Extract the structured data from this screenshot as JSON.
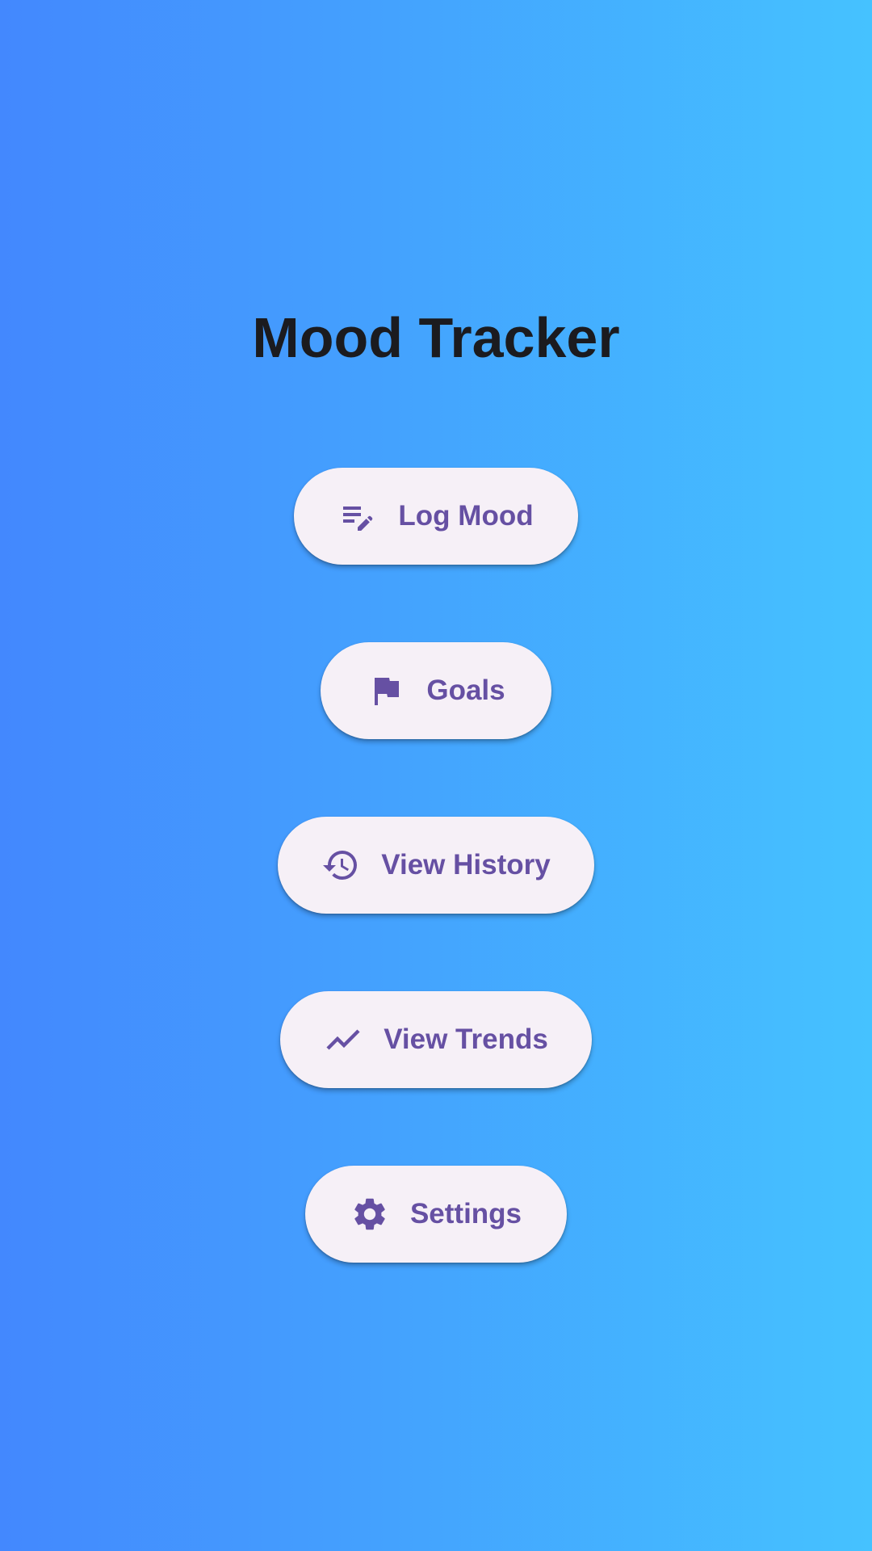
{
  "app": {
    "title": "Mood Tracker"
  },
  "menu": {
    "buttons": [
      {
        "label": "Log Mood",
        "icon": "edit-note-icon"
      },
      {
        "label": "Goals",
        "icon": "flag-icon"
      },
      {
        "label": "View History",
        "icon": "history-icon"
      },
      {
        "label": "View Trends",
        "icon": "trending-up-icon"
      },
      {
        "label": "Settings",
        "icon": "gear-icon"
      }
    ]
  },
  "colors": {
    "background_start": "#4388fe",
    "background_end": "#45c2ff",
    "title": "#1b1b1f",
    "button_bg": "#f6f0f7",
    "accent": "#6650a3"
  }
}
